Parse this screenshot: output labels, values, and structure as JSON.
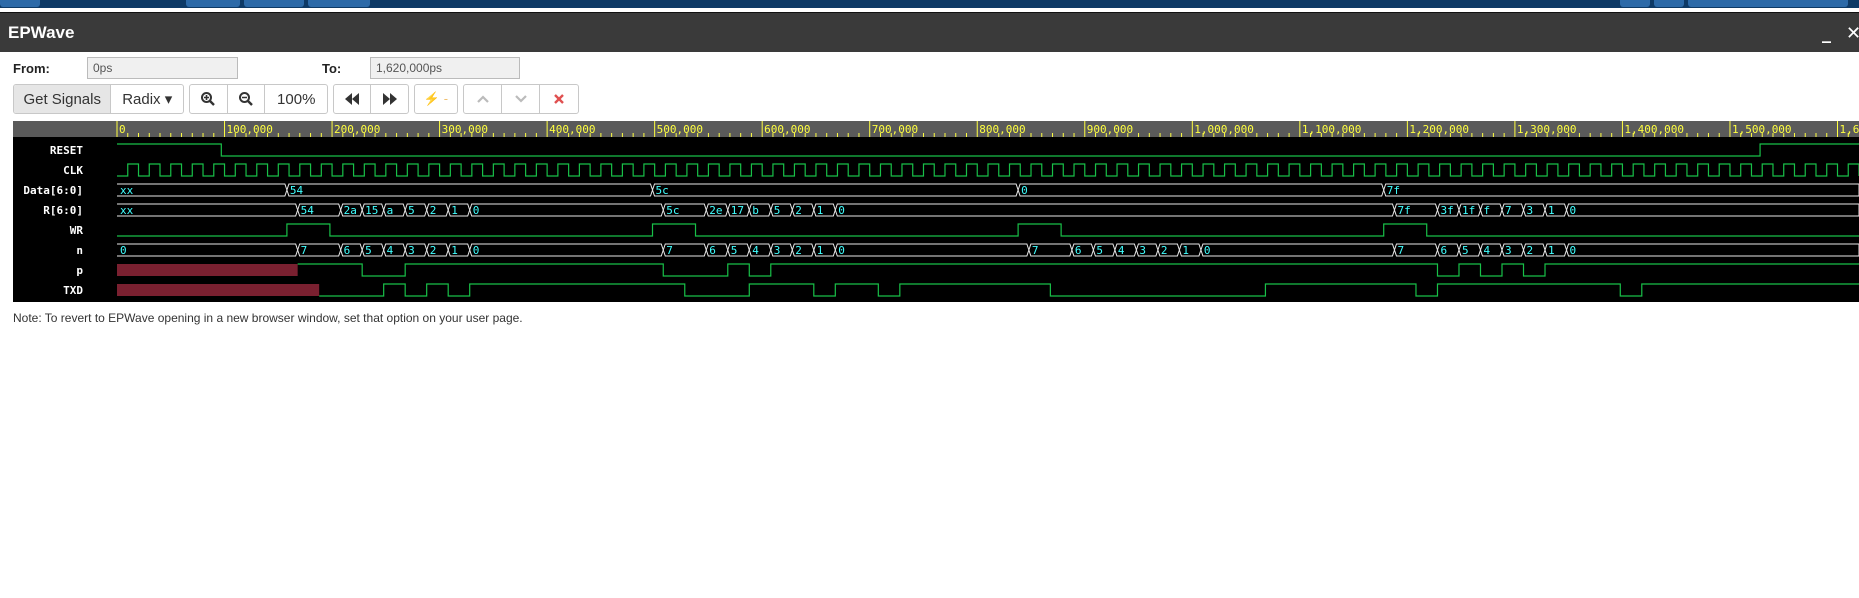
{
  "app": {
    "title": "EPWave",
    "minimize_glyph": "_",
    "close_glyph": "✕"
  },
  "range": {
    "from_label": "From:",
    "from_value": "0ps",
    "to_label": "To:",
    "to_value": "1,620,000ps"
  },
  "toolbar": {
    "get_signals": "Get Signals",
    "radix": "Radix ▾",
    "zoom_in_icon": "zoom-in-icon",
    "zoom_out_icon": "zoom-out-icon",
    "zoom_level": "100%",
    "prev_icon": "fast-backward-icon",
    "next_icon": "fast-forward-icon",
    "marker_label": "⚡ -",
    "up_icon": "chevron-up-icon",
    "down_icon": "chevron-down-icon",
    "clear_icon": "close-x-icon",
    "accent_colors": {
      "text": "#333333",
      "disabled": "#bbbbbb",
      "clear": "#e05050",
      "marker": "#f5c35a"
    }
  },
  "waveform": {
    "time_scale_end": 1620000,
    "timeline_ticks": [
      "0",
      "100,000",
      "200,000",
      "300,000",
      "400,000",
      "500,000",
      "600,000",
      "700,000",
      "800,000",
      "900,000",
      "1,000,000",
      "1,100,000",
      "1,200,000",
      "1,300,000",
      "1,400,000",
      "1,500,000",
      "1,6"
    ],
    "clock_period": 20000,
    "colors": {
      "background": "#000000",
      "axis": "#5a5a5a",
      "axis_text": "#ffff40",
      "signal_names": "#ffffff",
      "wave_line": "#18c048",
      "bus_line": "#e8e8e8",
      "bus_text": "#40ffff",
      "data_line": "#40d0d0",
      "x_fill": "#7a2030"
    },
    "signals": [
      {
        "name": "RESET",
        "kind": "bit",
        "start": 1,
        "transitions": [
          [
            97000,
            0
          ],
          [
            1528000,
            1
          ]
        ]
      },
      {
        "name": "CLK",
        "kind": "clock"
      },
      {
        "name": "Data[6:0]",
        "kind": "bus",
        "segments": [
          [
            0,
            "xx"
          ],
          [
            158000,
            "54"
          ],
          [
            498000,
            "5c"
          ],
          [
            838000,
            "0"
          ],
          [
            1178000,
            "7f"
          ]
        ]
      },
      {
        "name": "R[6:0]",
        "kind": "bus",
        "segments": [
          [
            0,
            "xx"
          ],
          [
            168000,
            "54"
          ],
          [
            208000,
            "2a"
          ],
          [
            228000,
            "15"
          ],
          [
            248000,
            "a"
          ],
          [
            268000,
            "5"
          ],
          [
            288000,
            "2"
          ],
          [
            308000,
            "1"
          ],
          [
            328000,
            "0"
          ],
          [
            508000,
            "5c"
          ],
          [
            548000,
            "2e"
          ],
          [
            568000,
            "17"
          ],
          [
            588000,
            "b"
          ],
          [
            608000,
            "5"
          ],
          [
            628000,
            "2"
          ],
          [
            648000,
            "1"
          ],
          [
            668000,
            "0"
          ],
          [
            1188000,
            "7f"
          ],
          [
            1228000,
            "3f"
          ],
          [
            1248000,
            "1f"
          ],
          [
            1268000,
            "f"
          ],
          [
            1288000,
            "7"
          ],
          [
            1308000,
            "3"
          ],
          [
            1328000,
            "1"
          ],
          [
            1348000,
            "0"
          ]
        ]
      },
      {
        "name": "WR",
        "kind": "bit",
        "start": 0,
        "transitions": [
          [
            158000,
            1
          ],
          [
            198000,
            0
          ],
          [
            498000,
            1
          ],
          [
            538000,
            0
          ],
          [
            838000,
            1
          ],
          [
            878000,
            0
          ],
          [
            1178000,
            1
          ],
          [
            1218000,
            0
          ]
        ]
      },
      {
        "name": "n",
        "kind": "bus",
        "segments": [
          [
            0,
            "0"
          ],
          [
            168000,
            "7"
          ],
          [
            208000,
            "6"
          ],
          [
            228000,
            "5"
          ],
          [
            248000,
            "4"
          ],
          [
            268000,
            "3"
          ],
          [
            288000,
            "2"
          ],
          [
            308000,
            "1"
          ],
          [
            328000,
            "0"
          ],
          [
            508000,
            "7"
          ],
          [
            548000,
            "6"
          ],
          [
            568000,
            "5"
          ],
          [
            588000,
            "4"
          ],
          [
            608000,
            "3"
          ],
          [
            628000,
            "2"
          ],
          [
            648000,
            "1"
          ],
          [
            668000,
            "0"
          ],
          [
            848000,
            "7"
          ],
          [
            888000,
            "6"
          ],
          [
            908000,
            "5"
          ],
          [
            928000,
            "4"
          ],
          [
            948000,
            "3"
          ],
          [
            968000,
            "2"
          ],
          [
            988000,
            "1"
          ],
          [
            1008000,
            "0"
          ],
          [
            1188000,
            "7"
          ],
          [
            1228000,
            "6"
          ],
          [
            1248000,
            "5"
          ],
          [
            1268000,
            "4"
          ],
          [
            1288000,
            "3"
          ],
          [
            1308000,
            "2"
          ],
          [
            1328000,
            "1"
          ],
          [
            1348000,
            "0"
          ]
        ]
      },
      {
        "name": "p",
        "kind": "bit",
        "start": "x",
        "xEnd": 168000,
        "transitions": [
          [
            168000,
            1
          ],
          [
            228000,
            0
          ],
          [
            268000,
            1
          ],
          [
            508000,
            0
          ],
          [
            568000,
            1
          ],
          [
            588000,
            0
          ],
          [
            608000,
            1
          ],
          [
            1228000,
            0
          ],
          [
            1248000,
            1
          ],
          [
            1268000,
            0
          ],
          [
            1288000,
            1
          ],
          [
            1308000,
            0
          ],
          [
            1328000,
            1
          ]
        ]
      },
      {
        "name": "TXD",
        "kind": "bit",
        "start": "x",
        "xEnd": 188000,
        "transitions": [
          [
            188000,
            0
          ],
          [
            248000,
            1
          ],
          [
            268000,
            0
          ],
          [
            288000,
            1
          ],
          [
            308000,
            0
          ],
          [
            328000,
            1
          ],
          [
            528000,
            0
          ],
          [
            588000,
            1
          ],
          [
            648000,
            0
          ],
          [
            668000,
            1
          ],
          [
            708000,
            0
          ],
          [
            728000,
            1
          ],
          [
            868000,
            0
          ],
          [
            1068000,
            1
          ],
          [
            1208000,
            0
          ],
          [
            1228000,
            1
          ],
          [
            1398000,
            0
          ],
          [
            1418000,
            1
          ]
        ]
      }
    ]
  },
  "notes": "Note: To revert to EPWave opening in a new browser window, set that option on your user page."
}
